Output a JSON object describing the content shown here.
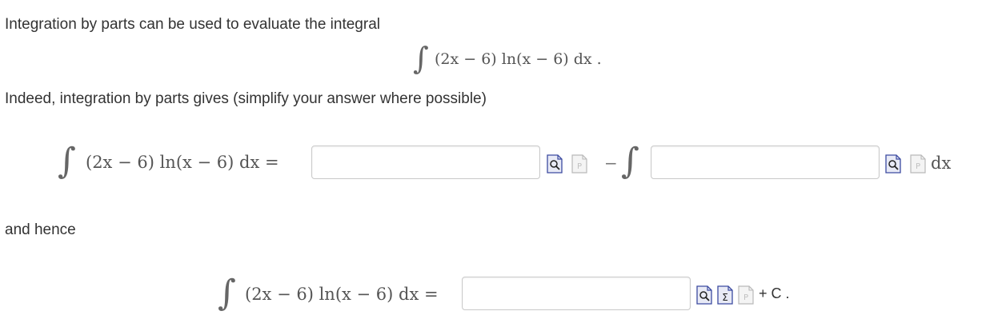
{
  "question": {
    "intro_text": "Integration by parts can be used to evaluate the integral",
    "integrand_display": "(2x − 6) ln(x − 6) dx .",
    "instruction_text": "Indeed, integration by parts gives (simplify your answer where possible)",
    "hence_text": "and hence",
    "lhs_expression": "(2x − 6) ln(x − 6) dx =",
    "minus_sign": "−",
    "dx_suffix": "dx",
    "constant_suffix": "+ C ."
  },
  "answers": {
    "uv_part": {
      "value": "",
      "placeholder": ""
    },
    "integral_part": {
      "value": "",
      "placeholder": ""
    },
    "final_result": {
      "value": "",
      "placeholder": ""
    }
  },
  "toolbar_icons": {
    "preview": "preview-icon",
    "help": "syntax-help-icon",
    "equation_editor": "equation-editor-icon"
  },
  "colors": {
    "text": "#333333",
    "math_text": "#555555",
    "input_border": "#c9c9c9",
    "icon_blue": "#3b4aa0"
  }
}
